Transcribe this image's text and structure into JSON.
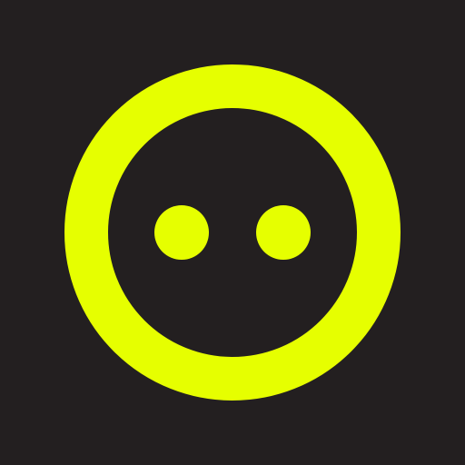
{
  "logo": {
    "icon": "eyes-circle-logo-icon",
    "background_color": "#231f20",
    "accent_color": "#e6ff00"
  }
}
